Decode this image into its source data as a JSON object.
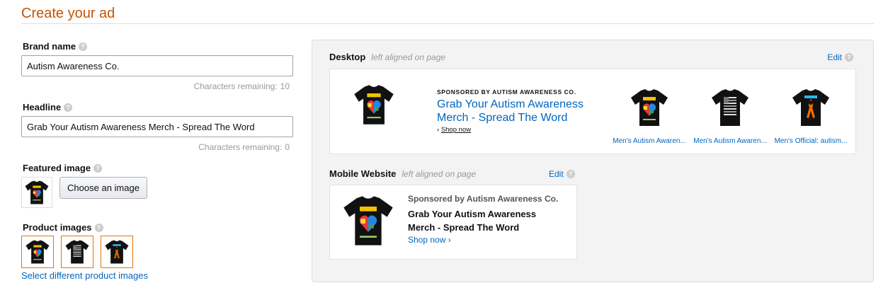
{
  "page": {
    "title": "Create your ad"
  },
  "brand": {
    "label": "Brand name",
    "value": "Autism Awareness Co.",
    "remaining_label": "Characters remaining:",
    "remaining_count": "10"
  },
  "headline": {
    "label": "Headline",
    "value": "Grab Your Autism Awareness Merch - Spread The Word",
    "remaining_label": "Characters remaining:",
    "remaining_count": "0"
  },
  "featured": {
    "label": "Featured image",
    "choose_button": "Choose an image"
  },
  "products": {
    "label": "Product images",
    "select_link": "Select different product images"
  },
  "desktop": {
    "name": "Desktop",
    "hint": "left aligned on page",
    "edit": "Edit",
    "sponsored": "SPONSORED BY AUTISM AWARENESS CO.",
    "headline": "Grab Your Autism Awareness Merch - Spread The Word",
    "shop_now": "Shop now",
    "items": [
      {
        "label": "Men's Autism Awaren..."
      },
      {
        "label": "Men's Autism Awaren..."
      },
      {
        "label": "Men's Official: autism..."
      }
    ]
  },
  "mobile": {
    "name": "Mobile Website",
    "hint": "left aligned on page",
    "edit": "Edit",
    "sponsored": "Sponsored by Autism Awareness Co.",
    "headline": "Grab Your Autism Awareness Merch - Spread The Word",
    "shop_now": "Shop now ›"
  },
  "icons": {
    "help": "question-mark-icon",
    "chevron": "chevron-right-icon",
    "tshirt": "tshirt-icon"
  },
  "colors": {
    "title": "#c45500",
    "link": "#0066c0",
    "selected_border": "#e77600",
    "panel_bg": "#f3f3f3"
  }
}
